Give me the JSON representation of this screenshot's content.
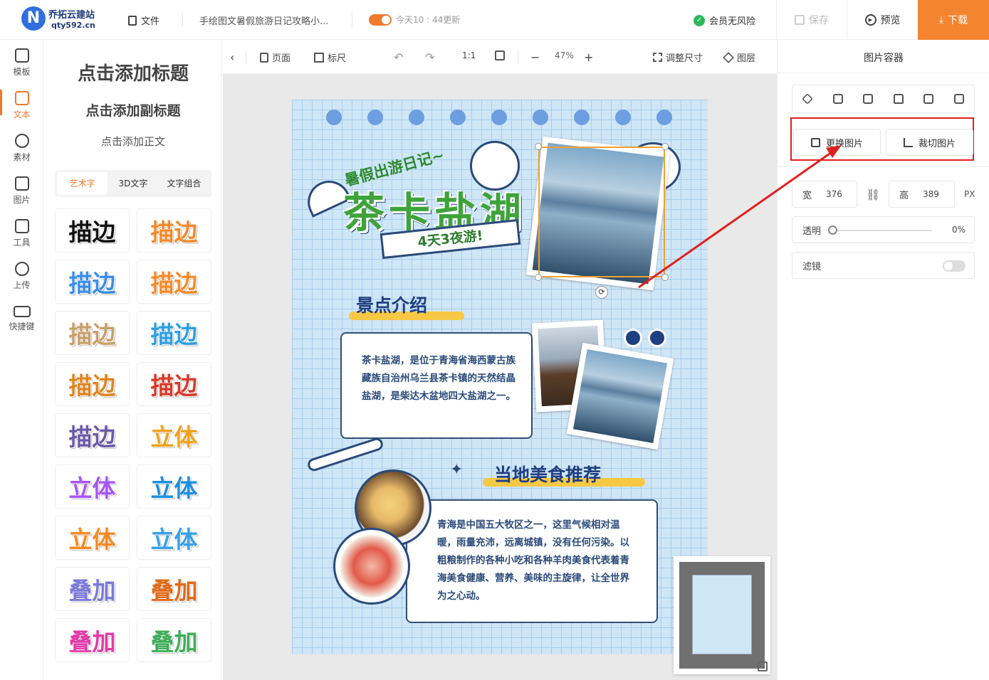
{
  "brand": {
    "name": "乔拓云建站",
    "domain": "qty592.cn",
    "logo_letter": "N"
  },
  "topbar": {
    "file_label": "文件",
    "doc_title": "手绘图文暑假旅游日记攻略小...",
    "autosave_text": "今天10 : 44更新",
    "member_text": "会员无风险",
    "save_label": "保存",
    "preview_label": "预览",
    "download_label": "下载"
  },
  "leftnav": [
    {
      "label": "模板",
      "icon": "template-icon"
    },
    {
      "label": "文本",
      "icon": "text-icon"
    },
    {
      "label": "素材",
      "icon": "material-icon"
    },
    {
      "label": "图片",
      "icon": "image-icon"
    },
    {
      "label": "工具",
      "icon": "toolbox-icon"
    },
    {
      "label": "上传",
      "icon": "upload-icon"
    },
    {
      "label": "快捷键",
      "icon": "keyboard-icon"
    }
  ],
  "panel": {
    "add_title": "点击添加标题",
    "add_subtitle": "点击添加副标题",
    "add_body": "点击添加正文",
    "tabs": [
      "艺术字",
      "3D文字",
      "文字组合"
    ],
    "tiles": [
      {
        "text": "描边",
        "color": "#111111"
      },
      {
        "text": "描边",
        "color": "#f28a2a"
      },
      {
        "text": "描边",
        "color": "#3a8ee6"
      },
      {
        "text": "描边",
        "color": "#f58b2a"
      },
      {
        "text": "描边",
        "color": "#c9a06a"
      },
      {
        "text": "描边",
        "color": "#2f9fe0"
      },
      {
        "text": "描边",
        "color": "#e0851f"
      },
      {
        "text": "描边",
        "color": "#d83a2a"
      },
      {
        "text": "描边",
        "color": "#6a5aa8"
      },
      {
        "text": "立体",
        "color": "#f0a21a"
      },
      {
        "text": "立体",
        "color": "#a855f7"
      },
      {
        "text": "立体",
        "color": "#1d8fe0"
      },
      {
        "text": "立体",
        "color": "#f58a1f"
      },
      {
        "text": "立体",
        "color": "#3aa0e8"
      },
      {
        "text": "叠加",
        "color": "#7a7ad8"
      },
      {
        "text": "叠加",
        "color": "#e06a1a"
      },
      {
        "text": "叠加",
        "color": "#e43aa8"
      },
      {
        "text": "叠加",
        "color": "#3fae5a"
      }
    ]
  },
  "toolbar": {
    "page_label": "页面",
    "ruler_label": "标尺",
    "ratio_label": "1:1",
    "zoom": "47%",
    "resize_label": "调整尺寸",
    "layers_label": "图层"
  },
  "poster": {
    "top_caption": "暑假出游日记~",
    "main_title": "茶卡盐湖",
    "ribbon": "4天3夜游!",
    "section1_title": "景点介绍",
    "section1_text": "茶卡盐湖，是位于青海省海西蒙古族藏族自治州乌兰县茶卡镇的天然结晶盐湖，是柴达木盆地四大盐湖之一。",
    "section2_title": "当地美食推荐",
    "section2_text": "青海是中国五大牧区之一，这里气候相对温暖，雨量充沛，远离城镇，没有任何污染。以粗粮制作的各种小吃和各种羊肉美食代表着青海美食健康、营养、美味的主旋律，让全世界为之心动。"
  },
  "rightpanel": {
    "title": "图片容器",
    "replace_label": "更换图片",
    "crop_label": "裁切图片",
    "width_label": "宽",
    "width_value": "376",
    "height_label": "高",
    "height_value": "389",
    "unit": "PX",
    "opacity_label": "透明",
    "opacity_value": "0%",
    "filter_label": "滤镜"
  },
  "colors": {
    "accent": "#f4842f",
    "highlight_box": "#e02020",
    "poster_bg": "#cfe6f7"
  }
}
